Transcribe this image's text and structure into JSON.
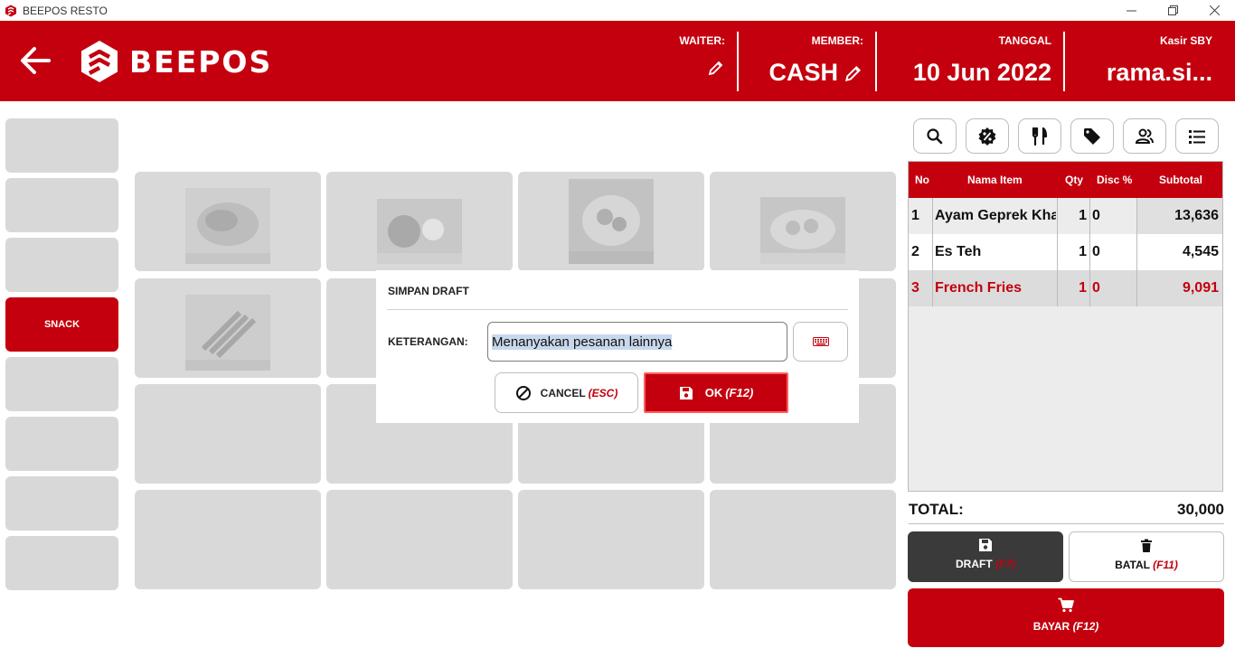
{
  "window": {
    "title": "BEEPOS RESTO"
  },
  "header": {
    "logo_text": "BEEPOS",
    "waiter_label": "WAITER:",
    "waiter_value": "",
    "member_label": "MEMBER:",
    "member_value": "CASH",
    "date_label": "TANGGAL",
    "date_value": "10 Jun 2022",
    "cashier_label": "Kasir SBY",
    "cashier_value": "rama.si..."
  },
  "categories": [
    {
      "label": "",
      "active": false
    },
    {
      "label": "",
      "active": false
    },
    {
      "label": "",
      "active": false
    },
    {
      "label": "SNACK",
      "active": true
    },
    {
      "label": "",
      "active": false
    },
    {
      "label": "",
      "active": false
    },
    {
      "label": "",
      "active": false
    },
    {
      "label": "",
      "active": false
    }
  ],
  "order": {
    "columns": {
      "no": "No",
      "name": "Nama Item",
      "qty": "Qty",
      "disc": "Disc %",
      "subtotal": "Subtotal"
    },
    "rows": [
      {
        "no": "1",
        "name": "Ayam Geprek Kha",
        "qty": "1",
        "disc": "0",
        "subtotal": "13,636"
      },
      {
        "no": "2",
        "name": "Es Teh",
        "qty": "1",
        "disc": "0",
        "subtotal": "4,545"
      },
      {
        "no": "3",
        "name": "French Fries",
        "qty": "1",
        "disc": "0",
        "subtotal": "9,091"
      }
    ],
    "total_label": "TOTAL:",
    "total_value": "30,000"
  },
  "actions": {
    "draft_label": "DRAFT",
    "draft_key": "(F7)",
    "batal_label": "BATAL",
    "batal_key": "(F11)",
    "bayar_label": "BAYAR",
    "bayar_key": "(F12)"
  },
  "modal": {
    "title": "SIMPAN DRAFT",
    "label": "KETERANGAN:",
    "input_value": "Menanyakan pesanan lainnya",
    "cancel_label": "CANCEL",
    "cancel_key": "(ESC)",
    "ok_label": "OK",
    "ok_key": "(F12)"
  },
  "colors": {
    "primary": "#c4000e",
    "dark": "#3a3a3a",
    "tile": "#d9d9d9"
  }
}
